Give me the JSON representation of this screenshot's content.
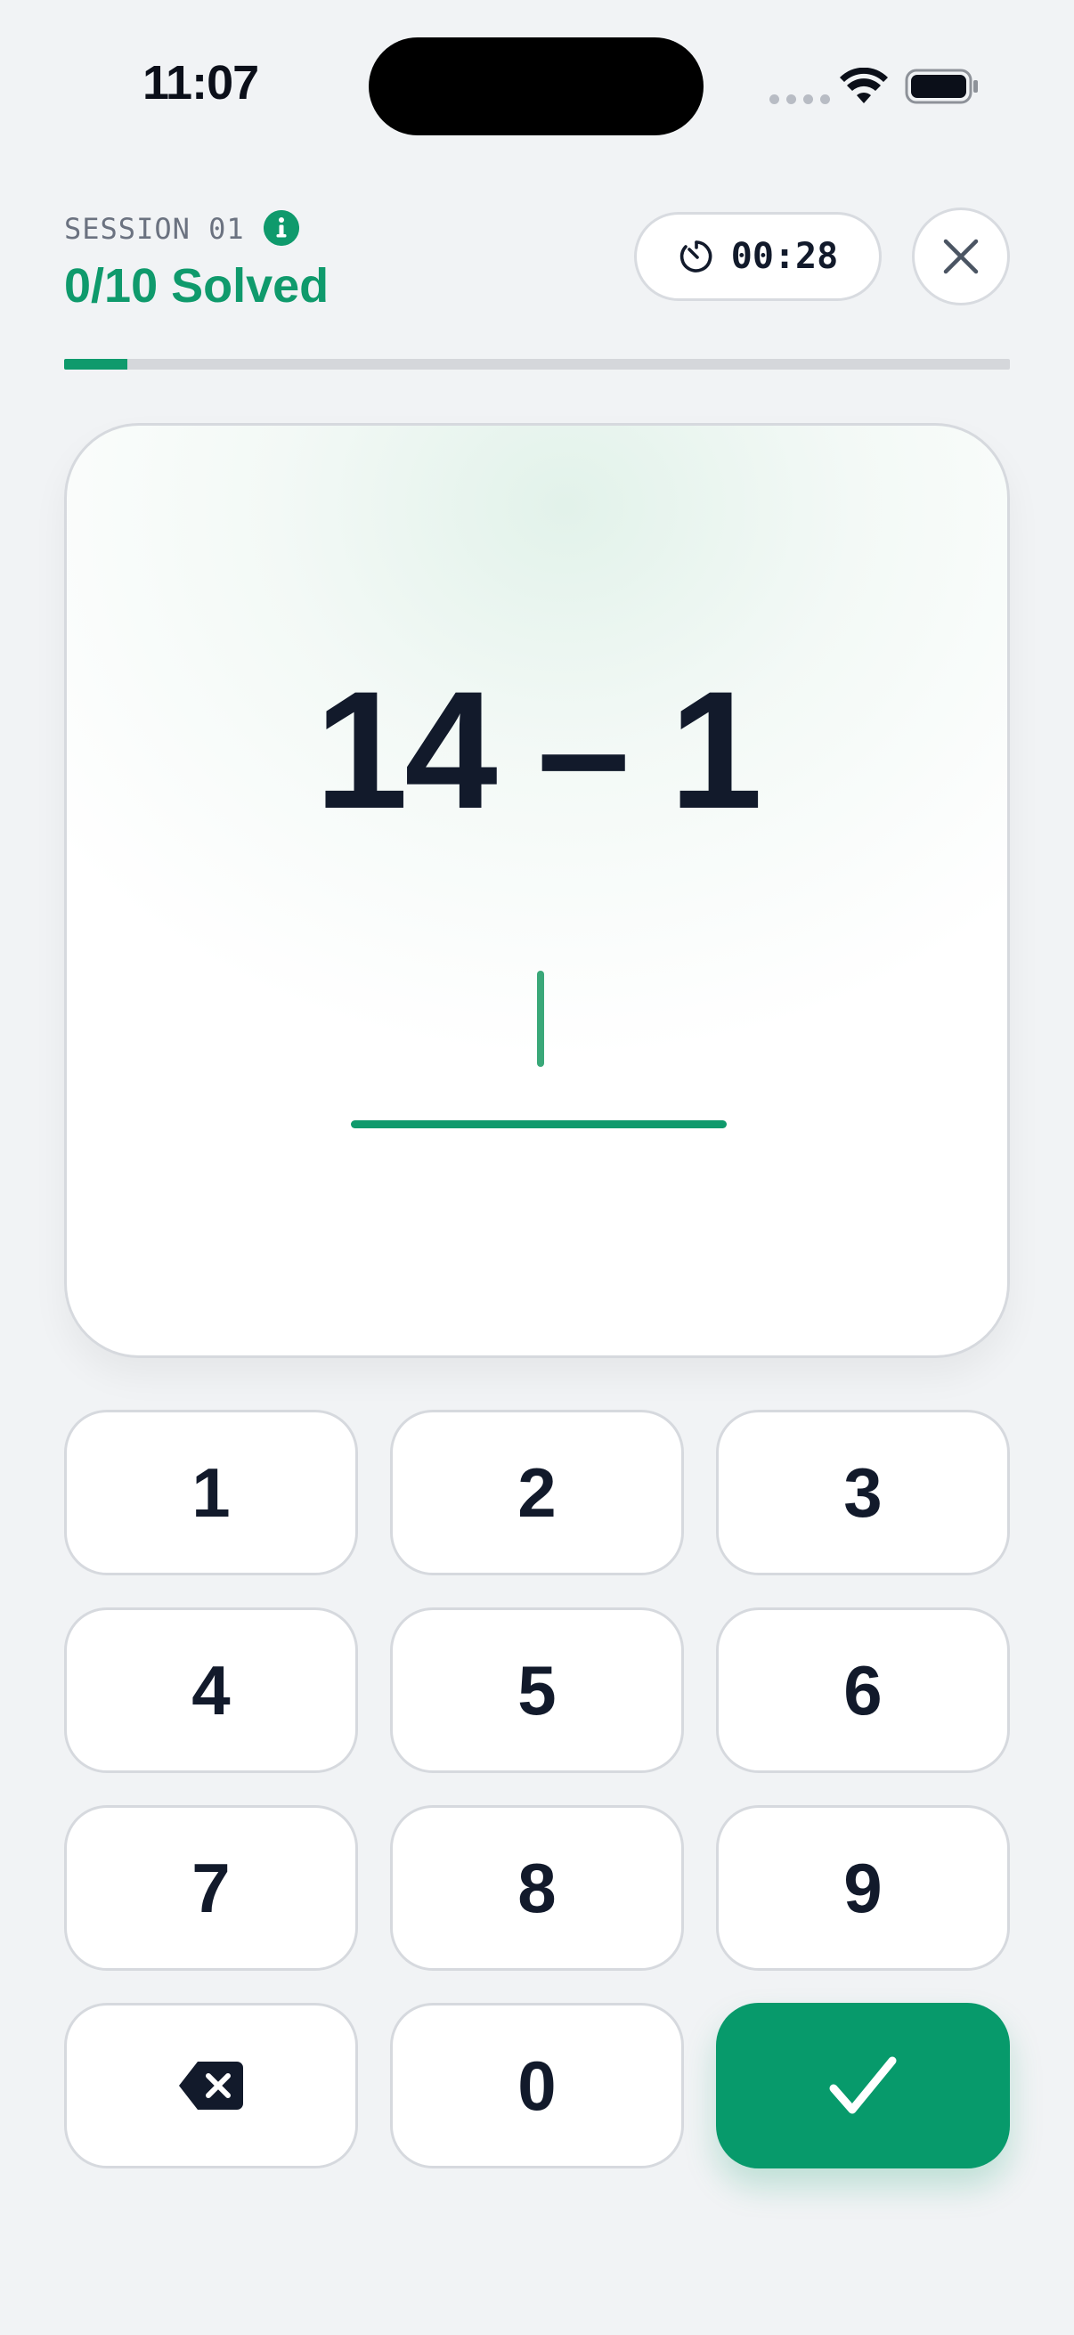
{
  "status_bar": {
    "time": "11:07"
  },
  "header": {
    "session_label": "SESSION 01",
    "solved_text": "0/10 Solved",
    "timer": "00:28",
    "progress": 0.067
  },
  "problem": {
    "expression": "14 – 1",
    "answer": ""
  },
  "keypad": {
    "keys": [
      "1",
      "2",
      "3",
      "4",
      "5",
      "6",
      "7",
      "8",
      "9"
    ],
    "zero": "0",
    "delete_icon": "backspace-icon",
    "submit_icon": "check-icon"
  },
  "colors": {
    "accent": "#0f9a6c",
    "text": "#121a2b",
    "background": "#f1f3f5"
  }
}
